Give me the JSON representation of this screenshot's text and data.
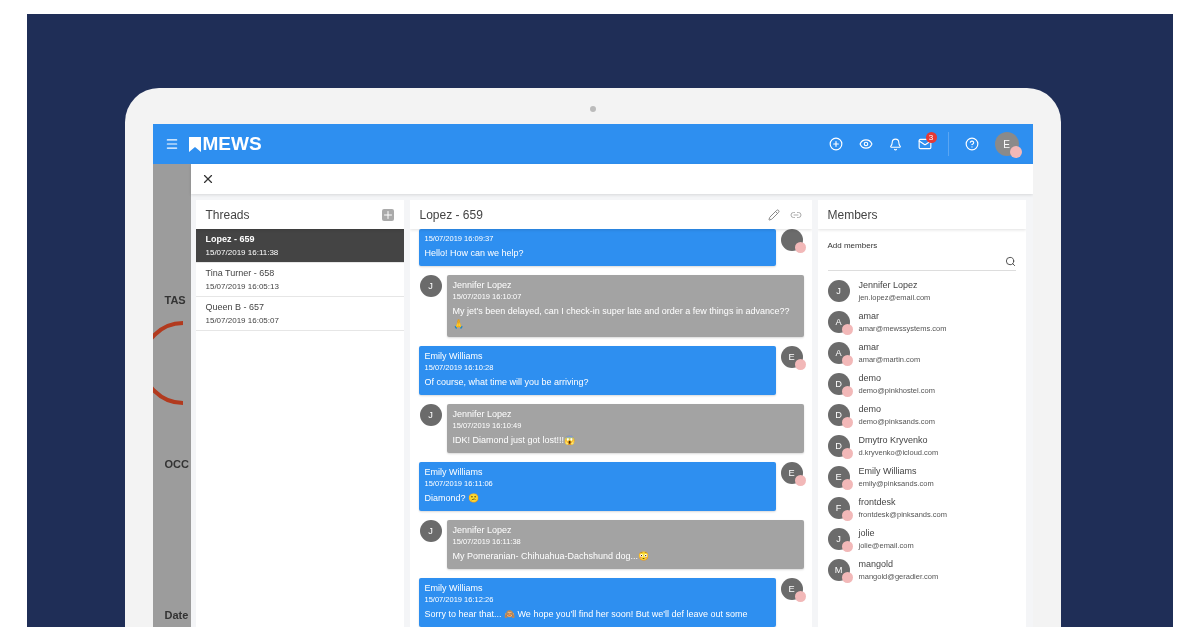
{
  "app": {
    "logo": "MEWS",
    "notification_count": "3",
    "avatar_letter": "E"
  },
  "background_page": {
    "labels": [
      "TAS",
      "OCC",
      "Date"
    ]
  },
  "threads": {
    "title": "Threads",
    "items": [
      {
        "name": "Lopez - 659",
        "time": "15/07/2019 16:11:38",
        "selected": true
      },
      {
        "name": "Tina Turner - 658",
        "time": "15/07/2019 16:05:13",
        "selected": false
      },
      {
        "name": "Queen B - 657",
        "time": "15/07/2019 16:05:07",
        "selected": false
      }
    ]
  },
  "conversation": {
    "title": "Lopez - 659",
    "messages": [
      {
        "kind": "staff",
        "time": "15/07/2019 16:09:37",
        "text": "Hello! How can we help?",
        "photo": true
      },
      {
        "kind": "guest",
        "sender": "Jennifer Lopez",
        "avatar": "J",
        "time": "15/07/2019 16:10:07",
        "text": "My jet's been delayed, can I check-in super late and order a few things in advance??🙏",
        "photo": false
      },
      {
        "kind": "staff",
        "sender": "Emily Williams",
        "avatar": "E",
        "time": "15/07/2019 16:10:28",
        "text": "Of course, what time will you be arriving?",
        "photo": true
      },
      {
        "kind": "guest",
        "sender": "Jennifer Lopez",
        "avatar": "J",
        "time": "15/07/2019 16:10:49",
        "text": "IDK! Diamond just got lost!!!😱",
        "photo": false
      },
      {
        "kind": "staff",
        "sender": "Emily Williams",
        "avatar": "E",
        "time": "15/07/2019 16:11:06",
        "text": "Diamond? 😕",
        "photo": true
      },
      {
        "kind": "guest",
        "sender": "Jennifer Lopez",
        "avatar": "J",
        "time": "15/07/2019 16:11:38",
        "text": "My Pomeranian- Chihuahua-Dachshund dog...😳",
        "photo": false
      },
      {
        "kind": "staff",
        "sender": "Emily Williams",
        "avatar": "E",
        "time": "15/07/2019 16:12:26",
        "text": "Sorry to hear that... 🙈 We hope you'll find her soon! But we'll def leave out some",
        "photo": true
      }
    ]
  },
  "members": {
    "title": "Members",
    "add_label": "Add members",
    "items": [
      {
        "avatar": "J",
        "name": "Jennifer Lopez",
        "email": "jen.lopez@email.com",
        "photo": false
      },
      {
        "avatar": "A",
        "name": "amar",
        "email": "amar@mewssystems.com",
        "photo": true
      },
      {
        "avatar": "A",
        "name": "amar",
        "email": "amar@martin.com",
        "photo": true
      },
      {
        "avatar": "D",
        "name": "demo",
        "email": "demo@pinkhostel.com",
        "photo": true
      },
      {
        "avatar": "D",
        "name": "demo",
        "email": "demo@pinksands.com",
        "photo": true
      },
      {
        "avatar": "D",
        "name": "Dmytro Kryvenko",
        "email": "d.kryvenko@icloud.com",
        "photo": true
      },
      {
        "avatar": "E",
        "name": "Emily Williams",
        "email": "emily@pinksands.com",
        "photo": true
      },
      {
        "avatar": "F",
        "name": "frontdesk",
        "email": "frontdesk@pinksands.com",
        "photo": true
      },
      {
        "avatar": "J",
        "name": "jolie",
        "email": "jolie@email.com",
        "photo": true
      },
      {
        "avatar": "M",
        "name": "mangold",
        "email": "mangold@geradier.com",
        "photo": true
      }
    ]
  }
}
